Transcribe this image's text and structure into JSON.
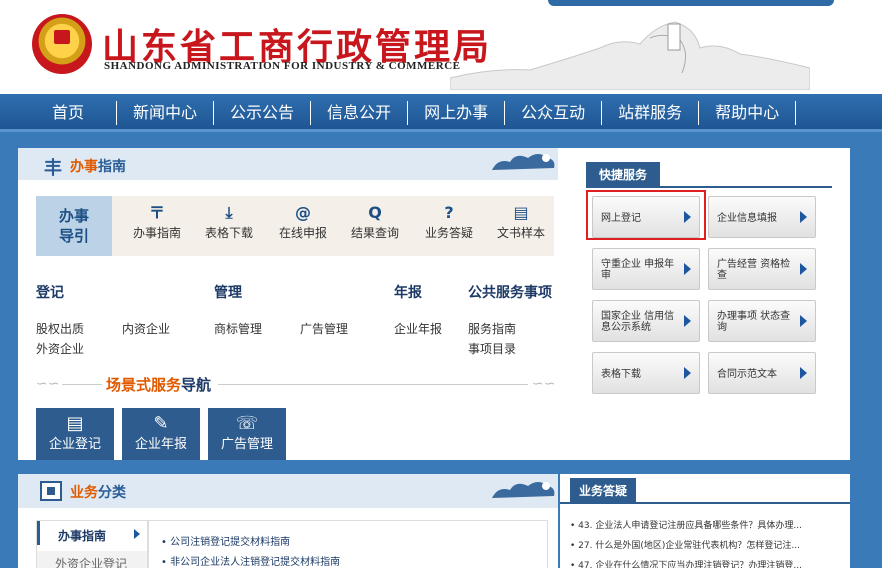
{
  "header": {
    "title_cn": "山东省工商行政管理局",
    "title_en": "SHANDONG ADMINISTRATION FOR INDUSTRY & COMMERCE"
  },
  "nav": {
    "items": [
      "首页",
      "新闻中心",
      "公示公告",
      "信息公开",
      "网上办事",
      "公众互动",
      "站群服务",
      "帮助中心"
    ]
  },
  "guide": {
    "panel_title_hl": "办事",
    "panel_title_rest": "指南",
    "badge_line1": "办事",
    "badge_line2": "导引",
    "items": [
      {
        "icon": "〒",
        "label": "办事指南"
      },
      {
        "icon": "⤓",
        "label": "表格下载"
      },
      {
        "icon": "@",
        "label": "在线申报"
      },
      {
        "icon": "Q",
        "label": "结果查询"
      },
      {
        "icon": "?",
        "label": "业务答疑"
      },
      {
        "icon": "▤",
        "label": "文书样本"
      }
    ]
  },
  "categories": {
    "register": {
      "title": "登记",
      "links": [
        "股权出质",
        "内资企业",
        "外资企业"
      ]
    },
    "manage": {
      "title": "管理",
      "links": [
        "商标管理",
        "广告管理"
      ]
    },
    "annual": {
      "title": "年报",
      "links": [
        "企业年报"
      ]
    },
    "public": {
      "title": "公共服务事项",
      "links": [
        "服务指南",
        "事项目录"
      ]
    }
  },
  "scene": {
    "title_hl": "场景式服务",
    "title_rest": "导航",
    "buttons": [
      {
        "icon": "▤",
        "label": "企业登记"
      },
      {
        "icon": "✎",
        "label": "企业年报"
      },
      {
        "icon": "☏",
        "label": "广告管理"
      }
    ]
  },
  "quick": {
    "title": "快捷服务",
    "buttons": [
      {
        "label": "网上登记"
      },
      {
        "label": "企业信息填报"
      },
      {
        "label": "守重企业 申报年审"
      },
      {
        "label": "广告经营 资格检查"
      },
      {
        "label": "国家企业 信用信息公示系统"
      },
      {
        "label": "办理事项 状态查询"
      },
      {
        "label": "表格下载"
      },
      {
        "label": "合同示范文本"
      }
    ]
  },
  "business": {
    "title_hl": "业务",
    "title_rest": "分类",
    "side_active": "办事指南",
    "side_other": "外资企业登记",
    "links": [
      "公司注销登记提交材料指南",
      "非公司企业法人注销登记提交材料指南"
    ]
  },
  "faq": {
    "title": "业务答疑",
    "items": [
      "43. 企业法人申请登记注册应具备哪些条件？具体办理...",
      "27. 什么是外国(地区)企业常驻代表机构？怎样登记注...",
      "47. 企业在什么情况下应当办理注销登记？办理注销登..."
    ]
  },
  "colors": {
    "brand_red": "#c8161d",
    "nav_blue": "#2f6fb0",
    "accent_orange": "#e05a00",
    "dark_blue": "#2f5c8f",
    "highlight_border": "#e02020"
  }
}
